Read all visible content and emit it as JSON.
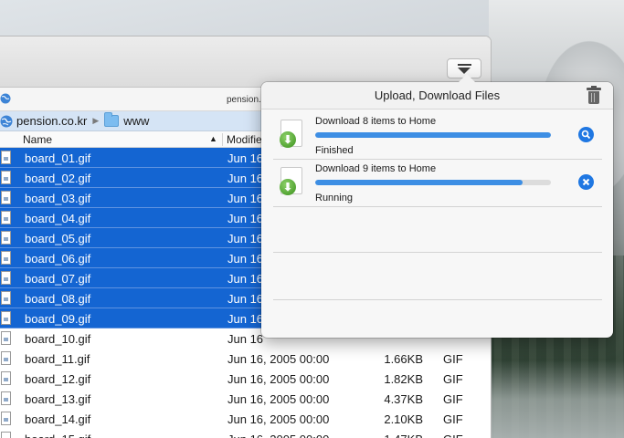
{
  "toolbar": {
    "view_menu_icon": "download-arrow-icon"
  },
  "location": {
    "host": "pension.co.kr"
  },
  "path": {
    "server": "pension.co.kr",
    "folder": "www"
  },
  "columns": {
    "name": "Name",
    "modified": "Modifie"
  },
  "files": [
    {
      "name": "board_01.gif",
      "date": "Jun 16",
      "size": "",
      "type": "",
      "selected": true
    },
    {
      "name": "board_02.gif",
      "date": "Jun 16",
      "size": "",
      "type": "",
      "selected": true
    },
    {
      "name": "board_03.gif",
      "date": "Jun 16",
      "size": "",
      "type": "",
      "selected": true
    },
    {
      "name": "board_04.gif",
      "date": "Jun 16",
      "size": "",
      "type": "",
      "selected": true
    },
    {
      "name": "board_05.gif",
      "date": "Jun 16",
      "size": "",
      "type": "",
      "selected": true
    },
    {
      "name": "board_06.gif",
      "date": "Jun 16",
      "size": "",
      "type": "",
      "selected": true
    },
    {
      "name": "board_07.gif",
      "date": "Jun 16",
      "size": "",
      "type": "",
      "selected": true
    },
    {
      "name": "board_08.gif",
      "date": "Jun 16",
      "size": "",
      "type": "",
      "selected": true
    },
    {
      "name": "board_09.gif",
      "date": "Jun 16",
      "size": "",
      "type": "",
      "selected": true
    },
    {
      "name": "board_10.gif",
      "date": "Jun 16",
      "size": "",
      "type": "",
      "selected": false
    },
    {
      "name": "board_11.gif",
      "date": "Jun 16, 2005 00:00",
      "size": "1.66KB",
      "type": "GIF",
      "selected": false
    },
    {
      "name": "board_12.gif",
      "date": "Jun 16, 2005 00:00",
      "size": "1.82KB",
      "type": "GIF",
      "selected": false
    },
    {
      "name": "board_13.gif",
      "date": "Jun 16, 2005 00:00",
      "size": "4.37KB",
      "type": "GIF",
      "selected": false
    },
    {
      "name": "board_14.gif",
      "date": "Jun 16, 2005 00:00",
      "size": "2.10KB",
      "type": "GIF",
      "selected": false
    },
    {
      "name": "board_15.gif",
      "date": "Jun 16, 2005 00:00",
      "size": "1.47KB",
      "type": "GIF",
      "selected": false
    }
  ],
  "popover": {
    "title": "Upload, Download Files",
    "jobs": [
      {
        "title": "Download 8 items to Home",
        "status": "Finished",
        "progress": 1.0,
        "action_icon": "reveal-magnifier-icon"
      },
      {
        "title": "Download 9 items to Home",
        "status": "Running",
        "progress": 0.88,
        "action_icon": "cancel-x-icon"
      }
    ]
  }
}
